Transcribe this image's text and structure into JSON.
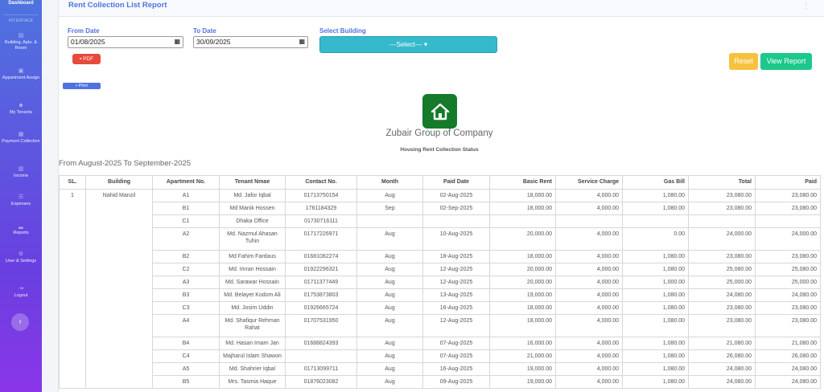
{
  "sidebar": {
    "brand": "Dashboard",
    "heading": "INTERFACE",
    "items": [
      {
        "label": "Building, Apts. & Room",
        "icon": "building-icon",
        "glyph": "▤"
      },
      {
        "label": "Appartment Assign",
        "icon": "id-card-icon",
        "glyph": "▣"
      },
      {
        "label": "My Tenants",
        "icon": "users-icon",
        "glyph": "☻"
      },
      {
        "label": "Payment Collection",
        "icon": "calculator-icon",
        "glyph": "▦"
      },
      {
        "label": "Income",
        "icon": "money-icon",
        "glyph": "▥"
      },
      {
        "label": "Expenses",
        "icon": "list-icon",
        "glyph": "☰"
      },
      {
        "label": "Reports",
        "icon": "chart-icon",
        "glyph": "▂"
      },
      {
        "label": "User & Settings",
        "icon": "user-settings-icon",
        "glyph": "⚙"
      },
      {
        "label": "Logout",
        "icon": "logout-icon",
        "glyph": "⇥"
      }
    ],
    "toggle_glyph": "›"
  },
  "header": {
    "title": "Rent Collection List Report",
    "menu_glyph": "⋮"
  },
  "filters": {
    "from_label": "From Date",
    "from_value": "01/08/2025",
    "to_label": "To Date",
    "to_value": "30/09/2025",
    "building_label": "Select Building",
    "building_value": "---Select---  ▾",
    "calendar_glyph": "▦"
  },
  "buttons": {
    "pdf": "▪ PDF",
    "print": "▪ Print",
    "reset": "Reset",
    "view": "View Report"
  },
  "report": {
    "company": "Zubair Group of Company",
    "title": "Housing Rent Collection Status",
    "period": "From August-2025 To September-2025",
    "logo_icon": "home-icon",
    "logo_color": "#157a2a"
  },
  "table": {
    "columns": [
      "SL.",
      "Building",
      "Apartment No.",
      "Tenant Nmae",
      "Contact No.",
      "Month",
      "Paid Date",
      "Basic Rent",
      "Service Charge",
      "Gas Bill",
      "Total",
      "Paid"
    ],
    "sl": "1",
    "building": "Nahid Manzil",
    "rows": [
      {
        "apt": "A1",
        "tenant": "Md. Jafor Iqbal",
        "contact": "01713750154",
        "month": "Aug",
        "paid_date": "02-Aug-2025",
        "basic": "18,000.00",
        "service": "4,000.00",
        "gas": "1,080.00",
        "total": "23,080.00",
        "paid": "23,080.00",
        "tall": false
      },
      {
        "apt": "B1",
        "tenant": "Md Manik Hossen",
        "contact": "1761184329",
        "month": "Sep",
        "paid_date": "02-Sep-2025",
        "basic": "18,000.00",
        "service": "4,000.00",
        "gas": "1,080.00",
        "total": "23,080.00",
        "paid": "23,080.00",
        "tall": false
      },
      {
        "apt": "C1",
        "tenant": "Dhaka Office",
        "contact": "01730716111",
        "month": "",
        "paid_date": "",
        "basic": "",
        "service": "",
        "gas": "",
        "total": "",
        "paid": "",
        "tall": false
      },
      {
        "apt": "A2",
        "tenant": "Md. Nazmul Ahasan Tuhin",
        "contact": "01717226971",
        "month": "Aug",
        "paid_date": "10-Aug-2025",
        "basic": "20,000.00",
        "service": "4,000.00",
        "gas": "0.00",
        "total": "24,000.00",
        "paid": "24,000.00",
        "tall": true
      },
      {
        "apt": "B2",
        "tenant": "Md Fahim Fardaus",
        "contact": "01681082274",
        "month": "Aug",
        "paid_date": "18-Aug-2025",
        "basic": "18,000.00",
        "service": "4,000.00",
        "gas": "1,080.00",
        "total": "23,080.00",
        "paid": "23,080.00",
        "tall": false
      },
      {
        "apt": "C2",
        "tenant": "Md. Imran Hossain",
        "contact": "01922296321",
        "month": "Aug",
        "paid_date": "12-Aug-2025",
        "basic": "20,000.00",
        "service": "4,000.00",
        "gas": "1,080.00",
        "total": "25,080.00",
        "paid": "25,080.00",
        "tall": false
      },
      {
        "apt": "A3",
        "tenant": "Md. Sarawar Hossain",
        "contact": "01711377449",
        "month": "Aug",
        "paid_date": "12-Aug-2025",
        "basic": "20,000.00",
        "service": "4,000.00",
        "gas": "1,000.00",
        "total": "25,000.00",
        "paid": "25,000.00",
        "tall": false
      },
      {
        "apt": "B3",
        "tenant": "Md. Belayet Kodom Ali",
        "contact": "01753873803",
        "month": "Aug",
        "paid_date": "13-Aug-2025",
        "basic": "19,000.00",
        "service": "4,000.00",
        "gas": "1,080.00",
        "total": "24,080.00",
        "paid": "24,080.00",
        "tall": false
      },
      {
        "apt": "C3",
        "tenant": "Md. Josim Uddin",
        "contact": "01926665724",
        "month": "Aug",
        "paid_date": "16-Aug-2025",
        "basic": "18,000.00",
        "service": "4,000.00",
        "gas": "1,080.00",
        "total": "23,080.00",
        "paid": "23,080.00",
        "tall": false
      },
      {
        "apt": "A4",
        "tenant": "Md. Shafiqur Rehman Rahat",
        "contact": "01707531950",
        "month": "Aug",
        "paid_date": "12-Aug-2025",
        "basic": "18,000.00",
        "service": "4,000.00",
        "gas": "1,080.00",
        "total": "23,080.00",
        "paid": "23,080.00",
        "tall": true
      },
      {
        "apt": "B4",
        "tenant": "Md. Hasan Imam Jan",
        "contact": "01688824393",
        "month": "Aug",
        "paid_date": "07-Aug-2025",
        "basic": "16,000.00",
        "service": "4,000.00",
        "gas": "1,080.00",
        "total": "21,080.00",
        "paid": "21,080.00",
        "tall": false
      },
      {
        "apt": "C4",
        "tenant": "Majharul Islam Shawon",
        "contact": "",
        "month": "Aug",
        "paid_date": "07-Aug-2025",
        "basic": "21,000.00",
        "service": "4,000.00",
        "gas": "1,080.00",
        "total": "26,080.00",
        "paid": "26,080.00",
        "tall": false
      },
      {
        "apt": "A5",
        "tenant": "Md. Shahrier Iqbal",
        "contact": "01713099711",
        "month": "Aug",
        "paid_date": "16-Aug-2025",
        "basic": "19,000.00",
        "service": "4,000.00",
        "gas": "1,080.00",
        "total": "24,080.00",
        "paid": "24,080.00",
        "tall": false
      },
      {
        "apt": "B5",
        "tenant": "Mrs. Tasmia Haque",
        "contact": "01876023082",
        "month": "Aug",
        "paid_date": "09-Aug-2025",
        "basic": "19,000.00",
        "service": "4,000.00",
        "gas": "1,080.00",
        "total": "24,080.00",
        "paid": "24,080.00",
        "tall": false
      }
    ]
  }
}
